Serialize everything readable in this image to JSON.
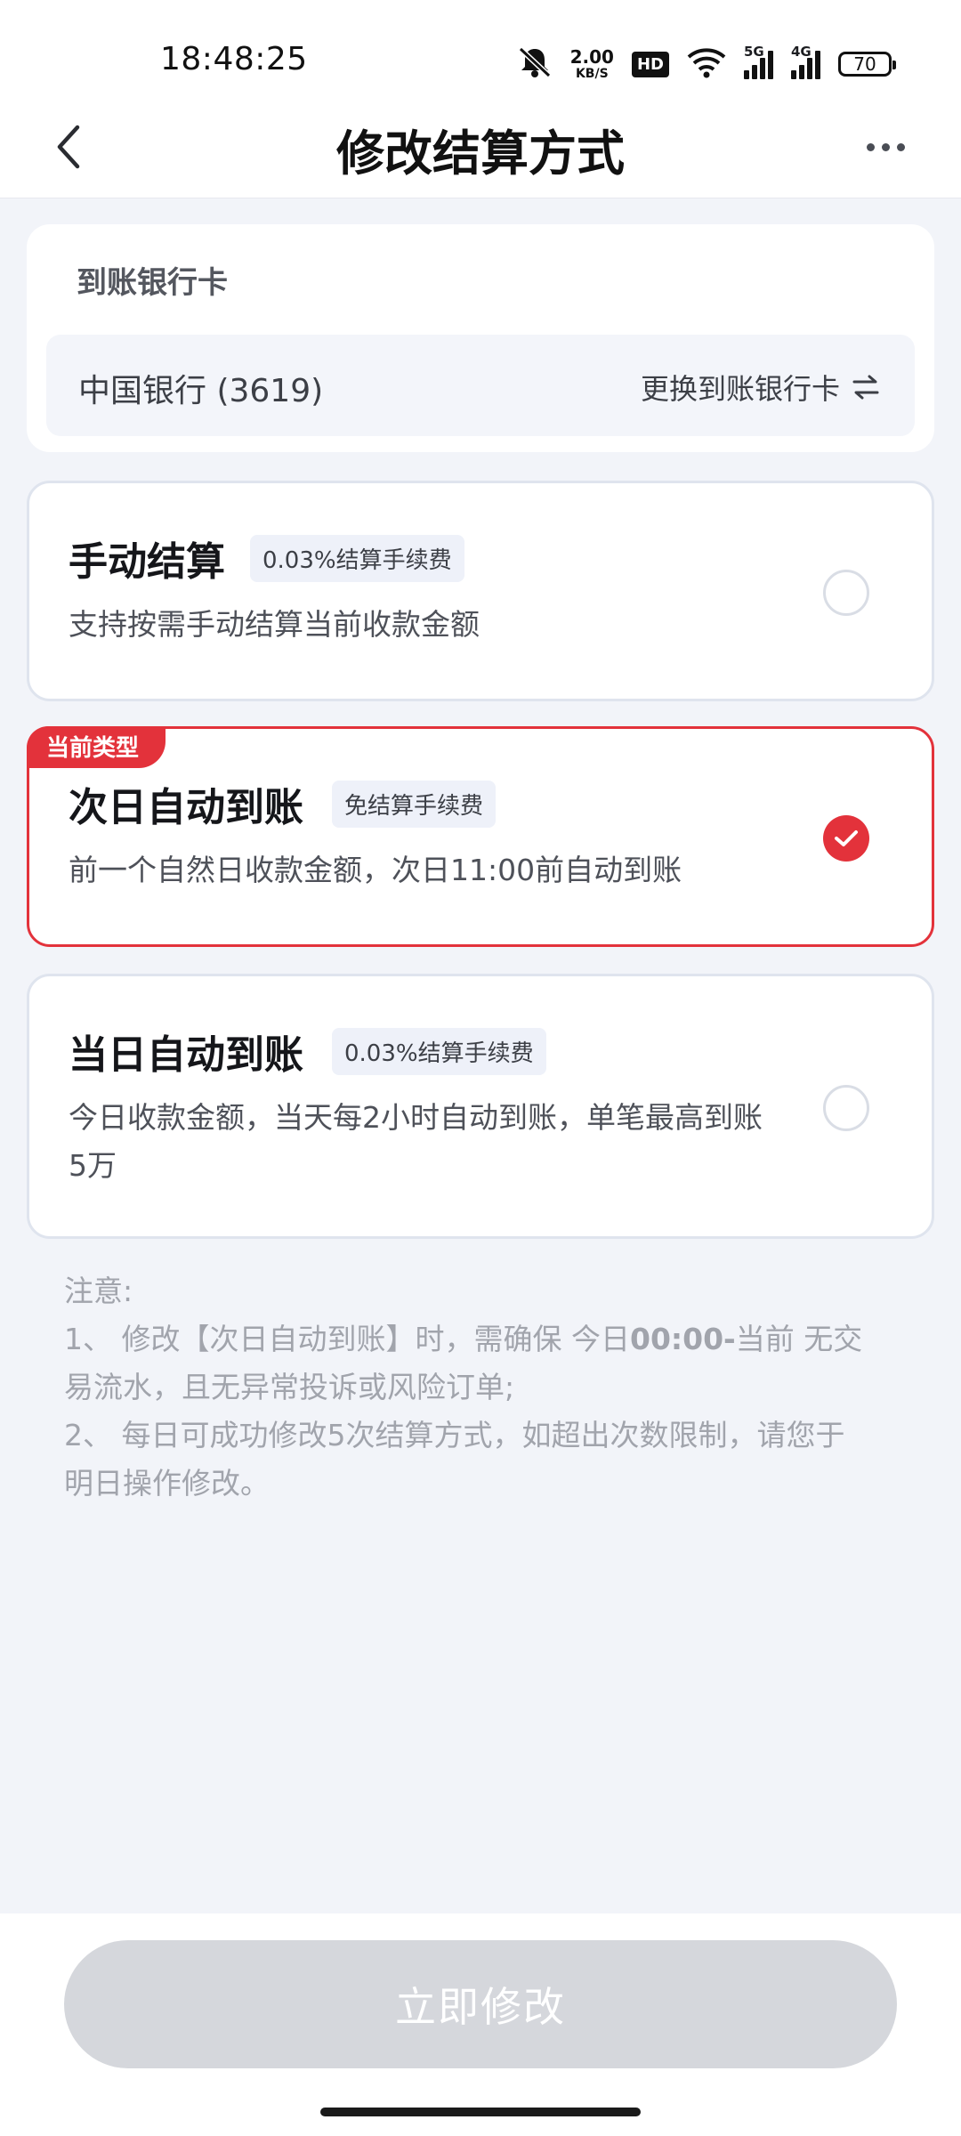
{
  "status_bar": {
    "time": "18:48:25",
    "net_speed_value": "2.00",
    "net_speed_unit": "KB/S",
    "hd_label": "HD",
    "signal1_label": "5G",
    "signal2_label": "4G",
    "battery": "70"
  },
  "header": {
    "title": "修改结算方式"
  },
  "bank_card": {
    "label": "到账银行卡",
    "bank_name": "中国银行 (3619)",
    "change_label": "更换到账银行卡"
  },
  "options": [
    {
      "title": "手动结算",
      "fee": "0.03%结算手续费",
      "desc": "支持按需手动结算当前收款金额",
      "selected": false
    },
    {
      "tag": "当前类型",
      "title": "次日自动到账",
      "fee": "免结算手续费",
      "desc": "前一个自然日收款金额，次日11:00前自动到账",
      "selected": true
    },
    {
      "title": "当日自动到账",
      "fee": "0.03%结算手续费",
      "desc_line1": "今日收款金额，当天每2小时自动到账，单笔最高到账",
      "desc_line2": "5万",
      "selected": false
    }
  ],
  "notice": {
    "title": "注意:",
    "item1_prefix": "1、 修改【次日自动到账】时，需确保 今日",
    "item1_bold": "00:00-",
    "item1_suffix_line1": "当前 无交",
    "item1_line2": "易流水，且无异常投诉或风险订单;",
    "item2_line1": "2、 每日可成功修改5次结算方式，如超出次数限制，请您于",
    "item2_line2": "明日操作修改。"
  },
  "footer": {
    "submit_label": "立即修改"
  },
  "colors": {
    "accent_red": "#e3323b",
    "disabled_button": "#d5d7dc",
    "background": "#f2f4f9"
  }
}
